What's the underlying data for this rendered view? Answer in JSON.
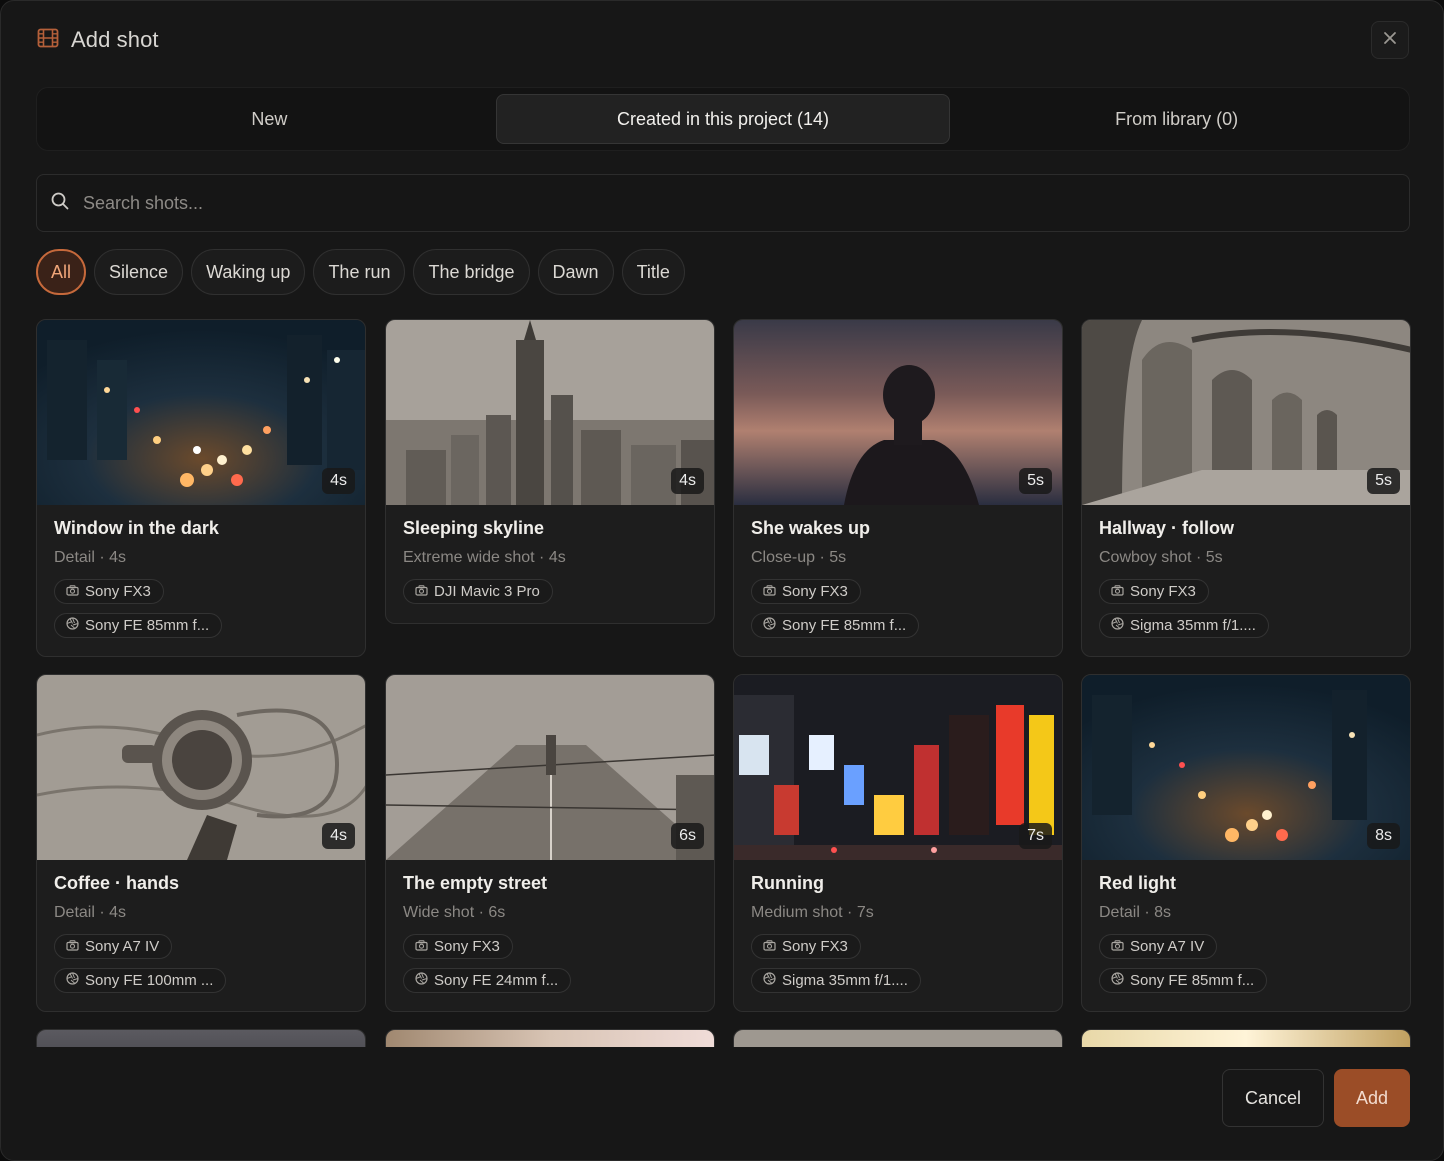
{
  "header": {
    "title": "Add shot",
    "icon": "film-icon",
    "close_icon": "close-icon"
  },
  "tabs": [
    {
      "label": "New",
      "active": false
    },
    {
      "label": "Created in this project (14)",
      "active": true
    },
    {
      "label": "From library (0)",
      "active": false
    }
  ],
  "search": {
    "placeholder": "Search shots...",
    "value": ""
  },
  "filters": [
    {
      "label": "All",
      "active": true
    },
    {
      "label": "Silence",
      "active": false
    },
    {
      "label": "Waking up",
      "active": false
    },
    {
      "label": "The run",
      "active": false
    },
    {
      "label": "The bridge",
      "active": false
    },
    {
      "label": "Dawn",
      "active": false
    },
    {
      "label": "Title",
      "active": false
    }
  ],
  "shots": [
    {
      "title": "Window in the dark",
      "meta": "Detail · 4s",
      "duration": "4s",
      "camera": "Sony FX3",
      "lens": "Sony FE 85mm f..."
    },
    {
      "title": "Sleeping skyline",
      "meta": "Extreme wide shot · 4s",
      "duration": "4s",
      "camera": "DJI Mavic 3 Pro",
      "lens": ""
    },
    {
      "title": "She wakes up",
      "meta": "Close-up · 5s",
      "duration": "5s",
      "camera": "Sony FX3",
      "lens": "Sony FE 85mm f..."
    },
    {
      "title": "Hallway · follow",
      "meta": "Cowboy shot · 5s",
      "duration": "5s",
      "camera": "Sony FX3",
      "lens": "Sigma 35mm f/1...."
    },
    {
      "title": "Coffee · hands",
      "meta": "Detail · 4s",
      "duration": "4s",
      "camera": "Sony A7 IV",
      "lens": "Sony FE 100mm ..."
    },
    {
      "title": "The empty street",
      "meta": "Wide shot · 6s",
      "duration": "6s",
      "camera": "Sony FX3",
      "lens": "Sony FE 24mm f..."
    },
    {
      "title": "Running",
      "meta": "Medium shot · 7s",
      "duration": "7s",
      "camera": "Sony FX3",
      "lens": "Sigma 35mm f/1...."
    },
    {
      "title": "Red light",
      "meta": "Detail · 8s",
      "duration": "8s",
      "camera": "Sony A7 IV",
      "lens": "Sony FE 85mm f..."
    }
  ],
  "footer": {
    "cancel_label": "Cancel",
    "add_label": "Add"
  },
  "colors": {
    "accent": "#c6693b",
    "add_button": "#9b4d27",
    "background": "#171717"
  }
}
